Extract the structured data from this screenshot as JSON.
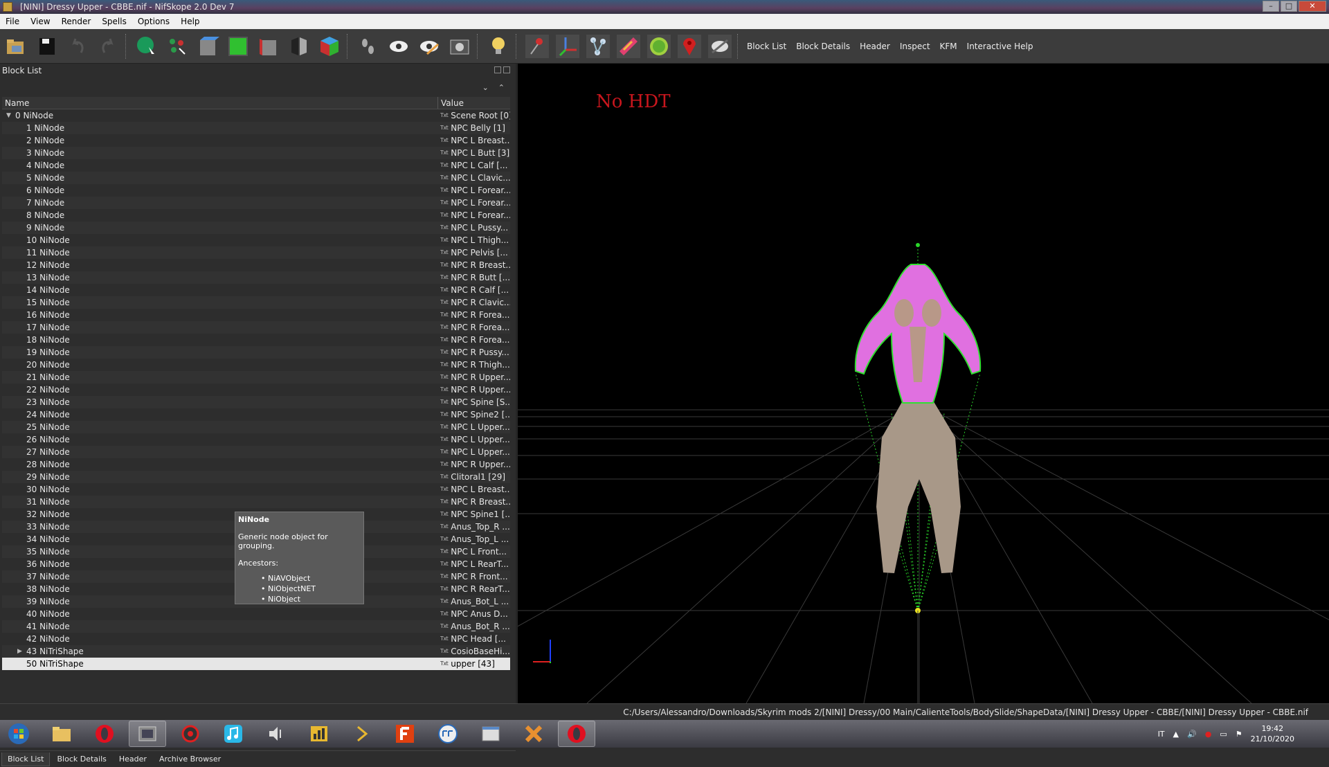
{
  "window": {
    "title": "[NINI] Dressy Upper - CBBE.nif - NifSkope 2.0 Dev 7"
  },
  "menu": [
    "File",
    "View",
    "Render",
    "Spells",
    "Options",
    "Help"
  ],
  "toolbar": {
    "text_tabs": [
      "Block List",
      "Block Details",
      "Header",
      "Inspect",
      "KFM",
      "Interactive Help"
    ]
  },
  "blocklist": {
    "title": "Block List",
    "col_name": "Name",
    "col_value": "Value",
    "txt_badge": "Txt",
    "rows": [
      {
        "name": "0 NiNode",
        "value": "Scene Root [0]"
      },
      {
        "name": "1 NiNode",
        "value": "NPC Belly [1]"
      },
      {
        "name": "2 NiNode",
        "value": "NPC L Breast..."
      },
      {
        "name": "3 NiNode",
        "value": "NPC L Butt [3]"
      },
      {
        "name": "4 NiNode",
        "value": "NPC L Calf [..."
      },
      {
        "name": "5 NiNode",
        "value": "NPC L Clavic..."
      },
      {
        "name": "6 NiNode",
        "value": "NPC L Forear..."
      },
      {
        "name": "7 NiNode",
        "value": "NPC L Forear..."
      },
      {
        "name": "8 NiNode",
        "value": "NPC L Forear..."
      },
      {
        "name": "9 NiNode",
        "value": "NPC L Pussy..."
      },
      {
        "name": "10 NiNode",
        "value": "NPC L Thigh..."
      },
      {
        "name": "11 NiNode",
        "value": "NPC Pelvis [..."
      },
      {
        "name": "12 NiNode",
        "value": "NPC R Breast..."
      },
      {
        "name": "13 NiNode",
        "value": "NPC R Butt [..."
      },
      {
        "name": "14 NiNode",
        "value": "NPC R Calf [..."
      },
      {
        "name": "15 NiNode",
        "value": "NPC R Clavic..."
      },
      {
        "name": "16 NiNode",
        "value": "NPC R Forea..."
      },
      {
        "name": "17 NiNode",
        "value": "NPC R Forea..."
      },
      {
        "name": "18 NiNode",
        "value": "NPC R Forea..."
      },
      {
        "name": "19 NiNode",
        "value": "NPC R Pussy..."
      },
      {
        "name": "20 NiNode",
        "value": "NPC R Thigh..."
      },
      {
        "name": "21 NiNode",
        "value": "NPC R Upper..."
      },
      {
        "name": "22 NiNode",
        "value": "NPC R Upper..."
      },
      {
        "name": "23 NiNode",
        "value": "NPC Spine [S..."
      },
      {
        "name": "24 NiNode",
        "value": "NPC Spine2 [..."
      },
      {
        "name": "25 NiNode",
        "value": "NPC L Upper..."
      },
      {
        "name": "26 NiNode",
        "value": "NPC L Upper..."
      },
      {
        "name": "27 NiNode",
        "value": "NPC L Upper..."
      },
      {
        "name": "28 NiNode",
        "value": "NPC R Upper..."
      },
      {
        "name": "29 NiNode",
        "value": "Clitoral1 [29]"
      },
      {
        "name": "30 NiNode",
        "value": "NPC L Breast..."
      },
      {
        "name": "31 NiNode",
        "value": "NPC R Breast..."
      },
      {
        "name": "32 NiNode",
        "value": "NPC Spine1 [..."
      },
      {
        "name": "33 NiNode",
        "value": "Anus_Top_R ..."
      },
      {
        "name": "34 NiNode",
        "value": "Anus_Top_L ..."
      },
      {
        "name": "35 NiNode",
        "value": "NPC L Front..."
      },
      {
        "name": "36 NiNode",
        "value": "NPC L RearT..."
      },
      {
        "name": "37 NiNode",
        "value": "NPC R Front..."
      },
      {
        "name": "38 NiNode",
        "value": "NPC R RearT..."
      },
      {
        "name": "39 NiNode",
        "value": "Anus_Bot_L ..."
      },
      {
        "name": "40 NiNode",
        "value": "NPC Anus D..."
      },
      {
        "name": "41 NiNode",
        "value": "Anus_Bot_R ..."
      },
      {
        "name": "42 NiNode",
        "value": "NPC Head [..."
      },
      {
        "name": "43 NiTriShape",
        "value": "CosioBaseHi..."
      },
      {
        "name": "50 NiTriShape",
        "value": "upper [43]"
      }
    ]
  },
  "tooltip": {
    "title": "NiNode",
    "description": "Generic node object for grouping.",
    "ancestors_label": "Ancestors:",
    "ancestors": [
      "NiAVObject",
      "NiObjectNET",
      "NiObject"
    ]
  },
  "bottom_tabs": [
    "Block List",
    "Block Details",
    "Header",
    "Archive Browser"
  ],
  "viewport": {
    "label": "No HDT",
    "label_color": "#c8161d"
  },
  "status": {
    "path": "C:/Users/Alessandro/Downloads/Skyrim mods 2/[NINI] Dressy/00 Main/CalienteTools/BodySlide/ShapeData/[NINI] Dressy Upper - CBBE/[NINI] Dressy Upper - CBBE.nif"
  },
  "taskbar": {
    "language": "IT",
    "time": "19:42",
    "date": "21/10/2020"
  }
}
